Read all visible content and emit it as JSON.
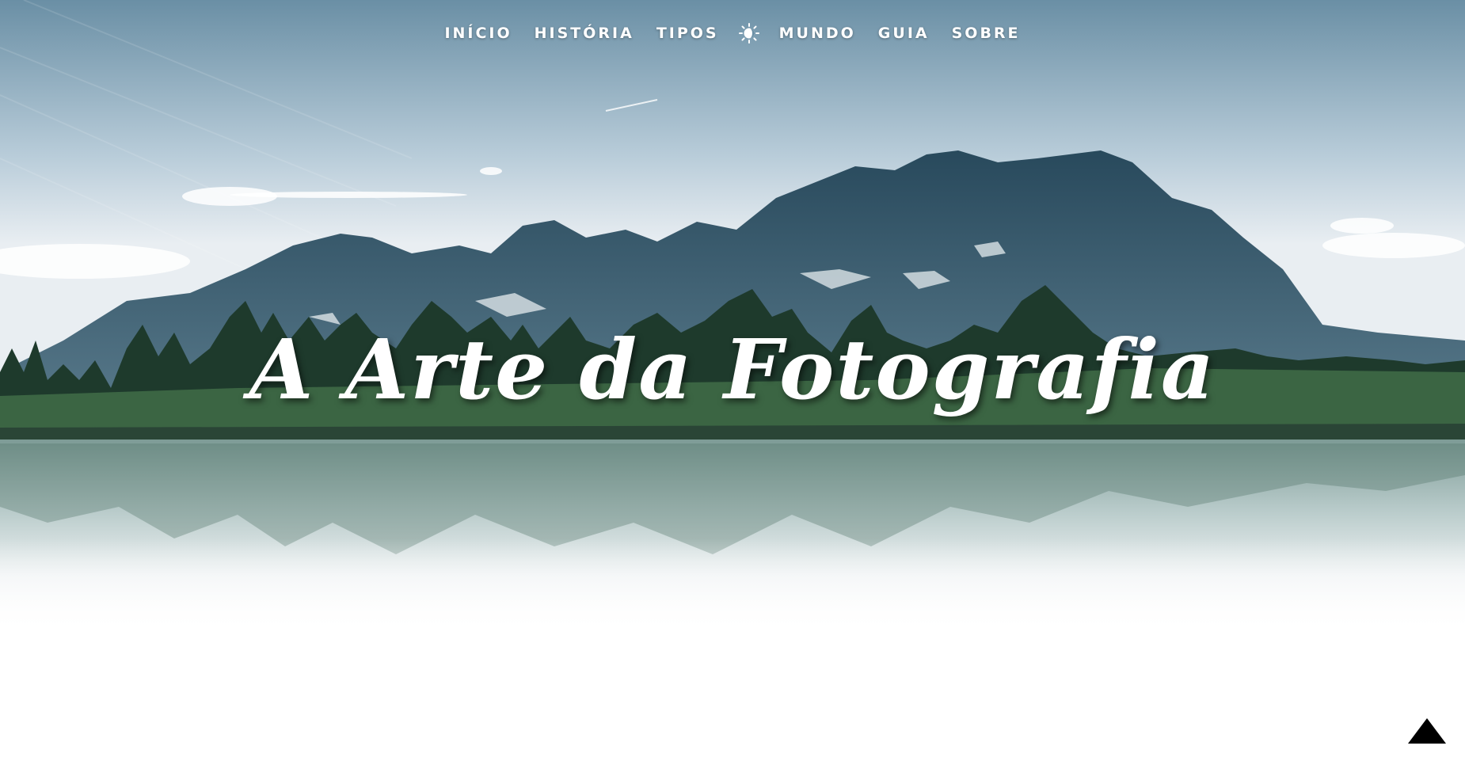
{
  "nav": {
    "items": [
      {
        "label": "INÍCIO"
      },
      {
        "label": "HISTÓRIA"
      },
      {
        "label": "TIPOS"
      },
      {
        "label": "MUNDO"
      },
      {
        "label": "GUIA"
      },
      {
        "label": "SOBRE"
      }
    ],
    "theme_toggle_icon": "sun-moon-icon"
  },
  "hero": {
    "title": "A Arte da Fotografia",
    "background_icon": "mountain-lake-image"
  },
  "back_to_top_icon": "triangle-up-icon",
  "colors": {
    "sky_top": "#6d93a8",
    "sky_bottom": "#e7eef3",
    "mountain": "#2f5163",
    "trees": "#1f3a2e",
    "grass": "#3d6a45",
    "text": "#ffffff"
  }
}
